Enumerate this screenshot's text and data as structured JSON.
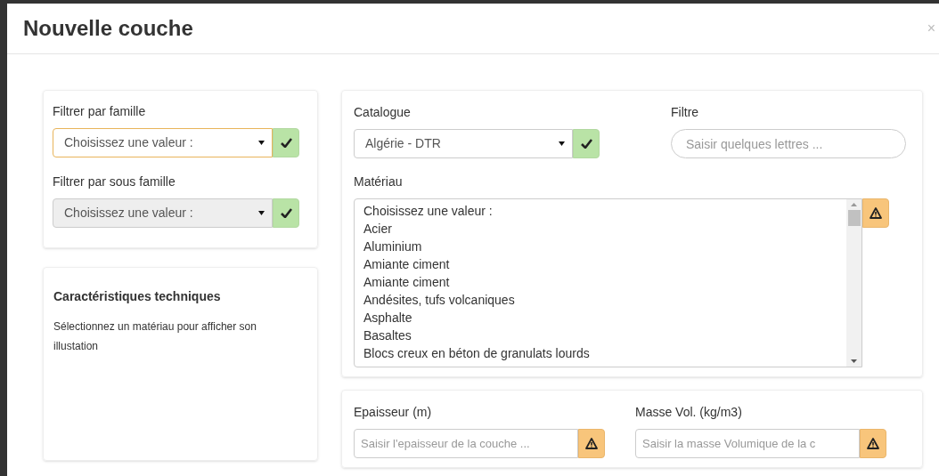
{
  "dialog": {
    "title": "Nouvelle couche",
    "close": "×"
  },
  "filters": [
    {
      "label": "Filtrer par famille",
      "value": "Choisissez une valeur :",
      "focused": true,
      "disabled": false,
      "kind": "valid"
    },
    {
      "label": "Filtrer par sous famille",
      "value": "Choisissez une valeur :",
      "focused": false,
      "disabled": true,
      "kind": "valid"
    }
  ],
  "characteristics": {
    "title": "Caractéristiques techniques",
    "text": "Sélectionnez un matériau pour afficher son illustation"
  },
  "catalogue": {
    "label": "Catalogue",
    "value": "Algérie - DTR",
    "focused": false,
    "disabled": false,
    "kind": "valid"
  },
  "filter_field": {
    "label": "Filtre",
    "placeholder": "Saisir quelques lettres ..."
  },
  "material": {
    "label": "Matériau",
    "kind": "warning",
    "options": [
      "Choisissez une valeur :",
      "Acier",
      "Aluminium",
      "Amiante ciment",
      "Amiante ciment",
      "Andésites, tufs volcaniques",
      "Asphalte",
      "Basaltes",
      "Blocs creux en béton de granulats lourds"
    ]
  },
  "fields": [
    {
      "label": "Epaisseur (m)",
      "placeholder": "Saisir l'epaisseur de la couche ...",
      "kind": "warning"
    },
    {
      "label": "Masse Vol. (kg/m3)",
      "placeholder": "Saisir la masse Volumique de la c",
      "kind": "warning"
    }
  ]
}
